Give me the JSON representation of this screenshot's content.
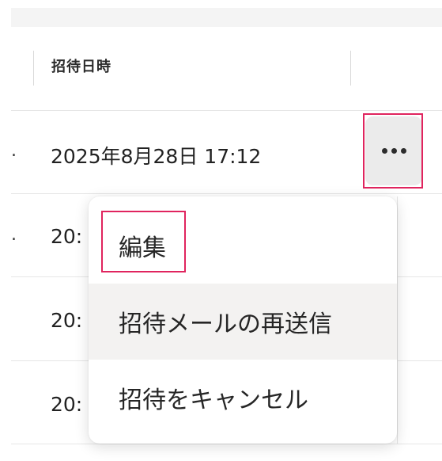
{
  "table": {
    "header": {
      "invited_at_label": "招待日時"
    },
    "rows": [
      {
        "prefix": ".",
        "invited_at": "2025年8月28日 17:12"
      },
      {
        "prefix": ".",
        "invited_at": "20:"
      },
      {
        "prefix": "",
        "invited_at": "20:"
      },
      {
        "prefix": "",
        "invited_at": "20:"
      }
    ]
  },
  "row_actions": {
    "more_icon": "more-horizontal-icon"
  },
  "context_menu": {
    "items": [
      {
        "label": "編集"
      },
      {
        "label": "招待メールの再送信"
      },
      {
        "label": "招待をキャンセル"
      }
    ]
  },
  "colors": {
    "annotation_highlight": "#e0245e",
    "hover_background": "#f3f2f1"
  }
}
